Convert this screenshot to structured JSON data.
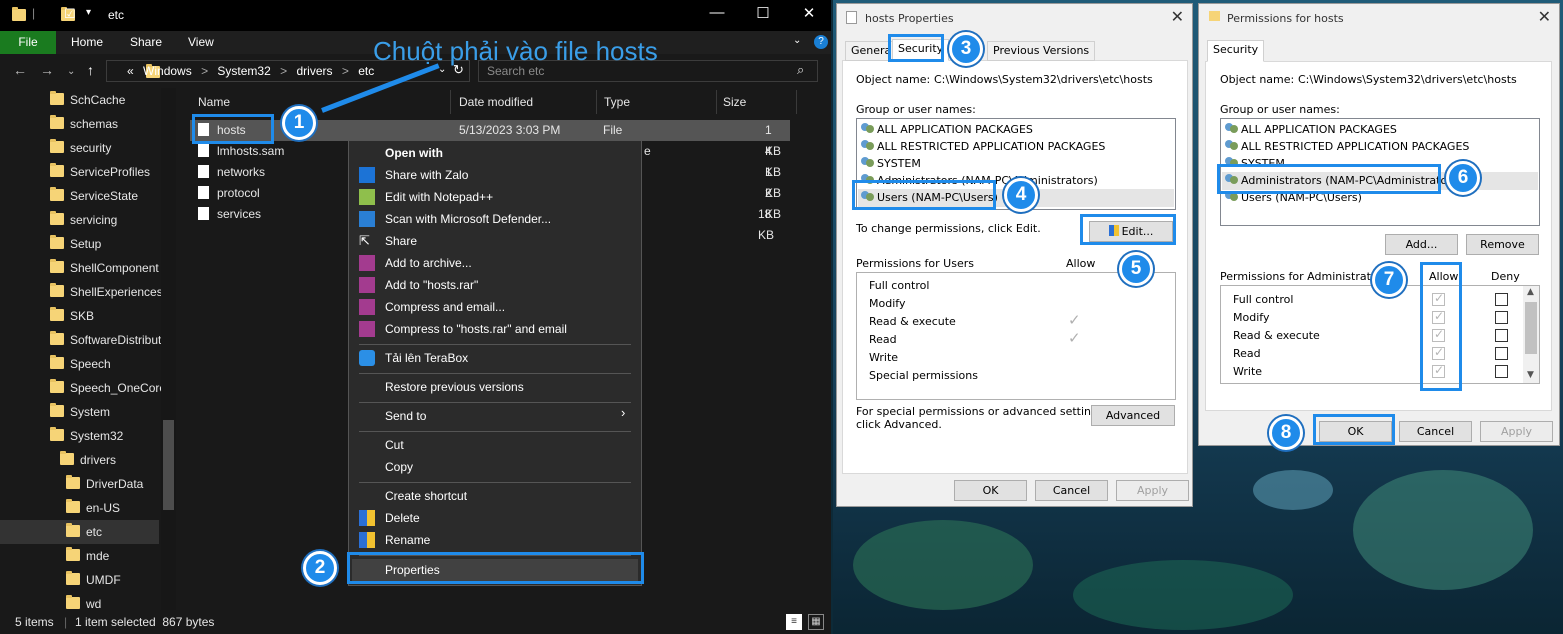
{
  "annotation": {
    "text": "Chuột phải vào file hosts"
  },
  "badges": [
    "1",
    "2",
    "3",
    "4",
    "5",
    "6",
    "7",
    "8"
  ],
  "explorer": {
    "title": "etc",
    "ribbon_tabs": [
      "File",
      "Home",
      "Share",
      "View"
    ],
    "breadcrumb": [
      "«",
      "Windows",
      ">",
      "System32",
      ">",
      "drivers",
      ">",
      "etc"
    ],
    "search_placeholder": "Search etc",
    "columns": [
      "Name",
      "Date modified",
      "Type",
      "Size"
    ],
    "sidebar": [
      "SchCache",
      "schemas",
      "security",
      "ServiceProfiles",
      "ServiceState",
      "servicing",
      "Setup",
      "ShellComponent",
      "ShellExperiences",
      "SKB",
      "SoftwareDistribut",
      "Speech",
      "Speech_OneCore",
      "System",
      "System32",
      "drivers",
      "DriverData",
      "en-US",
      "etc",
      "mde",
      "UMDF",
      "wd"
    ],
    "files": [
      {
        "name": "hosts",
        "date": "5/13/2023 3:03 PM",
        "type": "File",
        "size": "1 KB"
      },
      {
        "name": "lmhosts.sam",
        "date": "",
        "type": "e",
        "size": "4 KB"
      },
      {
        "name": "networks",
        "date": "",
        "type": "",
        "size": "1 KB"
      },
      {
        "name": "protocol",
        "date": "",
        "type": "",
        "size": "2 KB"
      },
      {
        "name": "services",
        "date": "",
        "type": "",
        "size": "18 KB"
      }
    ],
    "status": {
      "items": "5 items",
      "selected": "1 item selected  867 bytes"
    }
  },
  "context_menu": {
    "items": [
      "Open with",
      "Share with Zalo",
      "Edit with Notepad++",
      "Scan with Microsoft Defender...",
      "Share",
      "Add to archive...",
      "Add to \"hosts.rar\"",
      "Compress and email...",
      "Compress to \"hosts.rar\" and email",
      "Tải lên TeraBox",
      "Restore previous versions",
      "Send to",
      "Cut",
      "Copy",
      "Create shortcut",
      "Delete",
      "Rename",
      "Properties"
    ]
  },
  "props": {
    "title": "hosts Properties",
    "tabs": [
      "General",
      "Security",
      "Previous Versions"
    ],
    "object_label": "Object name:",
    "object_value": "C:\\Windows\\System32\\drivers\\etc\\hosts",
    "group_label": "Group or user names:",
    "groups": [
      "ALL APPLICATION PACKAGES",
      "ALL RESTRICTED APPLICATION PACKAGES",
      "SYSTEM",
      "Administrators (NAM-PC\\Administrators)",
      "Users (NAM-PC\\Users)"
    ],
    "change_hint": "To change permissions, click Edit.",
    "edit_btn": "Edit...",
    "perm_label": "Permissions for Users",
    "allow": "Allow",
    "perms": [
      "Full control",
      "Modify",
      "Read & execute",
      "Read",
      "Write",
      "Special permissions"
    ],
    "special_hint_1": "For special permissions or advanced settings,",
    "special_hint_2": "click Advanced.",
    "advanced_btn": "Advanced",
    "ok": "OK",
    "cancel": "Cancel",
    "apply": "Apply"
  },
  "perm_dlg": {
    "title": "Permissions for hosts",
    "tab": "Security",
    "object_label": "Object name:",
    "object_value": "C:\\Windows\\System32\\drivers\\etc\\hosts",
    "group_label": "Group or user names:",
    "groups": [
      "ALL APPLICATION PACKAGES",
      "ALL RESTRICTED APPLICATION PACKAGES",
      "SYSTEM",
      "Administrators (NAM-PC\\Administrators)",
      "Users (NAM-PC\\Users)"
    ],
    "add_btn": "Add...",
    "remove_btn": "Remove",
    "perm_label": "Permissions for Administrators",
    "allow": "Allow",
    "deny": "Deny",
    "perms": [
      "Full control",
      "Modify",
      "Read & execute",
      "Read",
      "Write"
    ],
    "ok": "OK",
    "cancel": "Cancel",
    "apply": "Apply"
  }
}
